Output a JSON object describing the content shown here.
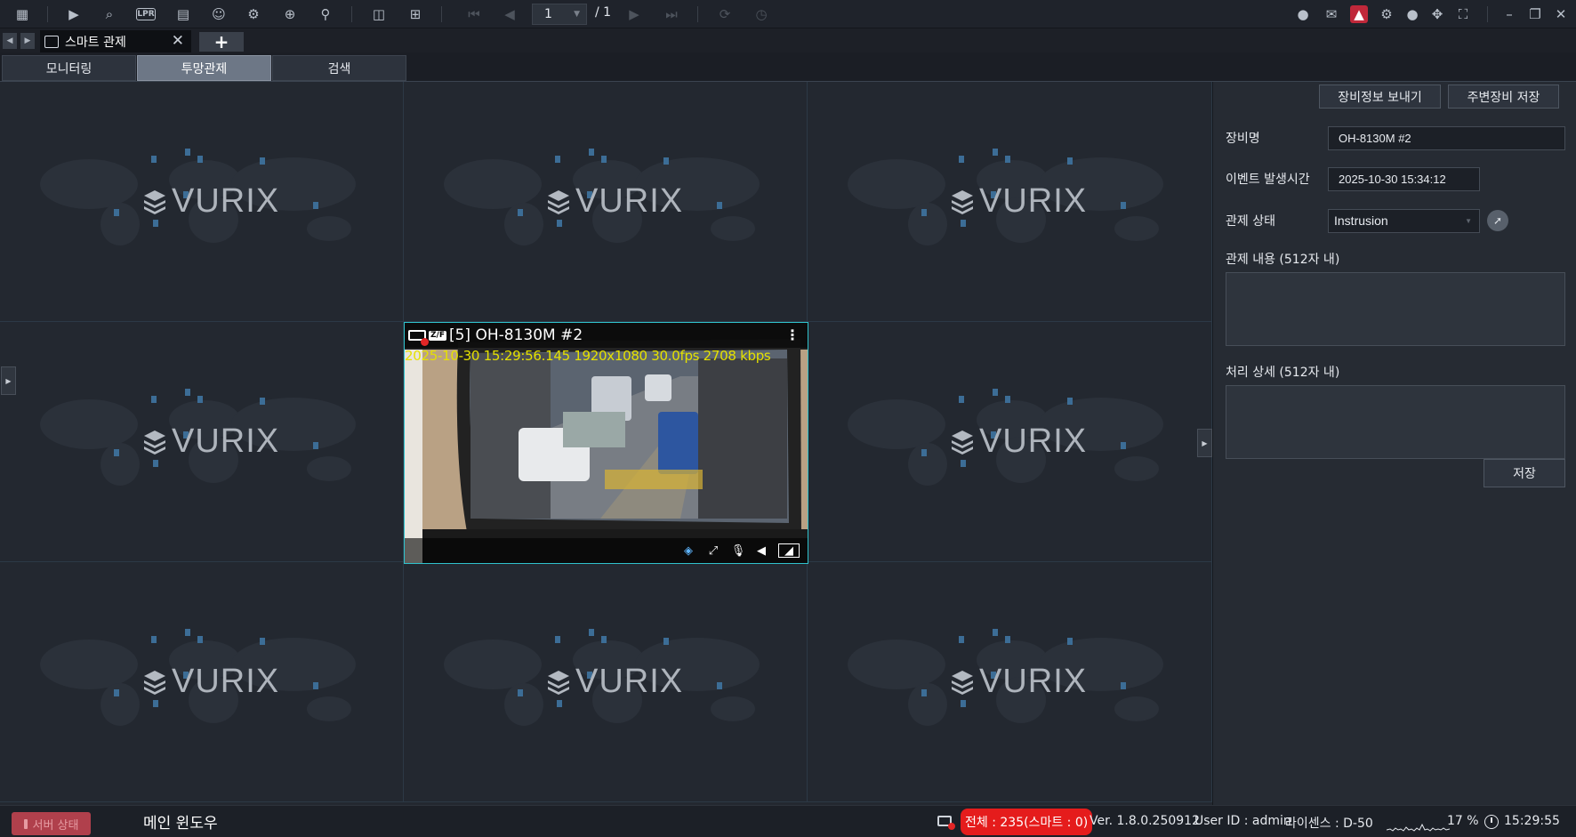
{
  "toolbar": {
    "icons": [
      "grid-menu-icon",
      "playback-icon",
      "video-search-icon",
      "lpr-icon",
      "camera-list-icon",
      "face-search-icon",
      "vehicle-search-icon",
      "map-search-icon",
      "event-search-icon",
      "layout-split-icon",
      "layout-add-icon",
      "first-page-icon",
      "prev-page-icon",
      "next-page-icon",
      "last-page-icon",
      "refresh-icon",
      "schedule-icon",
      "chat-icon",
      "message-icon",
      "alarm-icon",
      "settings-icon",
      "user-icon",
      "move-icon",
      "fullscreen-icon",
      "minimize-icon",
      "restore-icon",
      "close-icon"
    ],
    "lpr_label": "LPR",
    "page_current": "1",
    "page_total": "/ 1"
  },
  "tabs": {
    "active_label": "스마트 관제",
    "add_label": "+"
  },
  "subtabs": [
    "모니터링",
    "투망관제",
    "검색"
  ],
  "grid": {
    "watermark": "VURIX",
    "live": {
      "zf_badge": "Z/F",
      "title": "[5] OH-8130M #2",
      "osd": "2025-10-30 15:29:56.145 1920x1080  30.0fps 2708 kbps"
    }
  },
  "panel": {
    "send_info_button": "장비정보 보내기",
    "save_nearby_button": "주변장비 저장",
    "device_name_label": "장비명",
    "device_name_value": "OH-8130M #2",
    "event_time_label": "이벤트 발생시간",
    "event_time_value": "2025-10-30 15:34:12",
    "control_status_label": "관제 상태",
    "control_status_value": "Instrusion",
    "control_content_label": "관제 내용 (512자 내)",
    "process_detail_label": "처리 상세 (512자 내)",
    "save_button": "저장"
  },
  "status": {
    "server_status": "서버 상태",
    "main_window": "메인 윈도우",
    "total": "전체 : 235(스마트 : 0)",
    "version": "Ver. 1.8.0.250912",
    "user": "User ID : admin",
    "license": "라이센스 : D-50",
    "cpu": "17 %",
    "time": "15:29:55",
    "colors": {
      "alert": "#e51c1c",
      "accent": "#2fc2cc",
      "osd": "#e5e100"
    }
  }
}
